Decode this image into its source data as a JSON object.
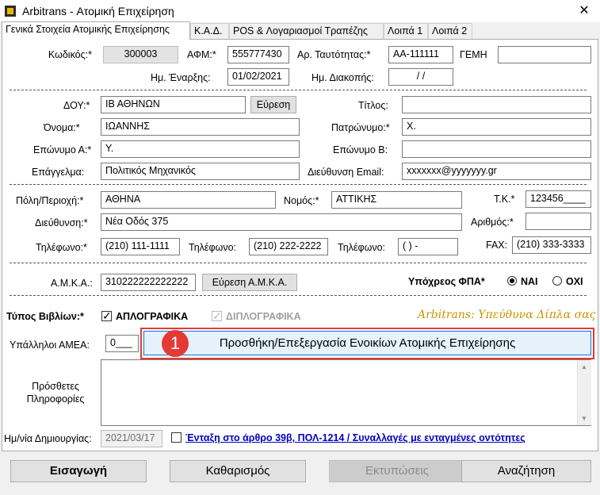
{
  "window": {
    "title": "Arbitrans - Ατομική Επιχείρηση",
    "close": "✕"
  },
  "tabs": [
    "Γενικά Στοιχεία Ατομικής Επιχείρησης",
    "Κ.Α.Δ.",
    "POS & Λογαριασμοί Τραπέζης",
    "Λοιπά 1",
    "Λοιπά 2"
  ],
  "row1": {
    "code_label": "Κωδικός:*",
    "code_value": "300003",
    "afm_label": "ΑΦΜ:*",
    "afm_value": "555777430",
    "id_label": "Αρ. Ταυτότητας:*",
    "id_value": "ΑΑ-111111",
    "gemi_label": "ΓΕΜΗ",
    "gemi_value": ""
  },
  "row2": {
    "start_label": "Ημ. Έναρξης:",
    "start_value": "01/02/2021",
    "end_label": "Ημ. Διακοπής:",
    "end_value": "/  /"
  },
  "personal": {
    "doy_label": "ΔΟΥ:*",
    "doy_value": "ΙΒ ΑΘΗΝΩΝ",
    "search_button": "Εύρεση",
    "title_label": "Τίτλος:",
    "title_value": "",
    "name_label": "Όνομα:*",
    "name_value": "ΙΩΑΝΝΗΣ",
    "father_label": "Πατρώνυμο:*",
    "father_value": "Χ.",
    "surname_a_label": "Επώνυμο Α:*",
    "surname_a_value": "Υ.",
    "surname_b_label": "Επώνυμο Β:",
    "surname_b_value": "",
    "profession_label": "Επάγγελμα:",
    "profession_value": "Πολιτικός Μηχανικός",
    "email_label": "Διεύθυνση Email:",
    "email_value": "xxxxxxx@yyyyyyy.gr"
  },
  "address": {
    "city_label": "Πόλη/Περιοχή:*",
    "city_value": "ΑΘΗΝΑ",
    "prefecture_label": "Νομός:*",
    "prefecture_value": "ΑΤΤΙΚΗΣ",
    "zip_label": "Τ.Κ.*",
    "zip_value": "123456____",
    "street_label": "Διεύθυνση:*",
    "street_value": "Νέα Οδός 375",
    "number_label": "Αριθμός:*",
    "number_value": "",
    "phone1_label": "Τηλέφωνο:*",
    "phone1_value": "(210) 111-1111",
    "phone2_label": "Τηλέφωνο:",
    "phone2_value": "(210) 222-2222",
    "phone3_label": "Τηλέφωνο:",
    "phone3_value": "(  )    -",
    "fax_label": "FAX:",
    "fax_value": "(210) 333-3333"
  },
  "amka": {
    "label": "Α.Μ.Κ.Α.:",
    "value": "310222222222222",
    "search_button": "Εύρεση Α.Μ.Κ.Α.",
    "vat_label": "Υπόχρεος ΦΠΑ*",
    "yes": "ΝΑΙ",
    "no": "ΟΧΙ"
  },
  "books": {
    "label": "Τύπος Βιβλίων:*",
    "single": "ΑΠΛΟΓΡΑΦΙΚΑ",
    "double": "ΔΙΠΛΟΓΡΑΦΙΚΑ",
    "slogan": "Arbitrans: Υπεύθυνα Δίπλα σας"
  },
  "employees": {
    "label": "Υπάλληλοι ΑΜΕΑ:",
    "value": "0___"
  },
  "callout": {
    "number": "1",
    "button": "Προσθήκη/Επεξεργασία Ενοικίων Ατομικής Επιχείρησης",
    "color": "#e53935"
  },
  "notes": {
    "label_line1": "Πρόσθετες",
    "label_line2": "Πληροφορίες",
    "value": ""
  },
  "created": {
    "label": "Ημ/νία Δημιουργίας:",
    "value": "2021/03/17",
    "link": "Ένταξη στο άρθρο 39β, ΠΟΛ-1214 / Συναλλαγές με ενταγμένες οντότητες"
  },
  "bottom": {
    "insert": "Εισαγωγή",
    "clear": "Καθαρισμός",
    "print": "Εκτυπώσεις",
    "search": "Αναζήτηση"
  }
}
